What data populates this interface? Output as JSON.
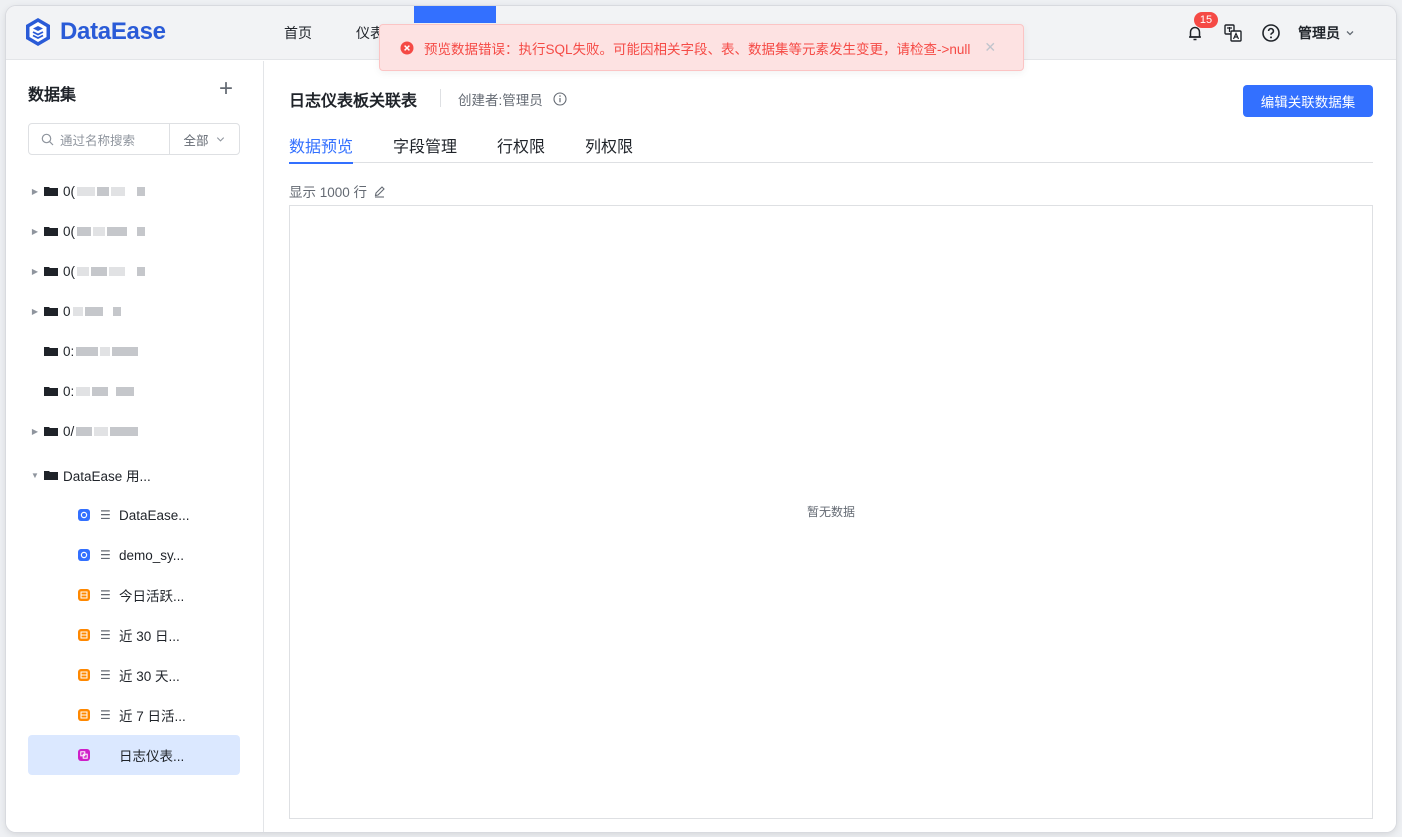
{
  "app": {
    "name": "DataEase"
  },
  "nav": {
    "items": [
      "首页",
      "仪表"
    ]
  },
  "toast": {
    "message": "预览数据错误：执行SQL失败。可能因相关字段、表、数据集等元素发生变更，请检查->null"
  },
  "header": {
    "notification_count": "15",
    "user": "管理员"
  },
  "sidebar": {
    "title": "数据集",
    "search_placeholder": "通过名称搜索",
    "filter": "全部",
    "folders": [
      {
        "prefix": "0("
      },
      {
        "prefix": "0("
      },
      {
        "prefix": "0("
      },
      {
        "prefix": "0"
      },
      {
        "prefix": "0:"
      },
      {
        "prefix": "0:"
      },
      {
        "prefix": "0/"
      },
      {
        "label": "DataEase 用..."
      }
    ],
    "datasets": [
      {
        "label": "DataEase...",
        "color": "#3370ff"
      },
      {
        "label": "demo_sy...",
        "color": "#3370ff"
      },
      {
        "label": "今日活跃...",
        "color": "#ff8800"
      },
      {
        "label": "近 30 日...",
        "color": "#ff8800"
      },
      {
        "label": "近 30 天...",
        "color": "#ff8800"
      },
      {
        "label": "近 7 日活...",
        "color": "#ff8800"
      },
      {
        "label": "日志仪表...",
        "color": "#cf1ec8"
      }
    ]
  },
  "main": {
    "title": "日志仪表板关联表",
    "creator": "创建者:管理员",
    "edit_button": "编辑关联数据集",
    "tabs": [
      "数据预览",
      "字段管理",
      "行权限",
      "列权限"
    ],
    "rows_info": "显示 1000 行",
    "empty_text": "暂无数据"
  },
  "colors": {
    "primary": "#3370ff",
    "error": "#f54a45"
  }
}
